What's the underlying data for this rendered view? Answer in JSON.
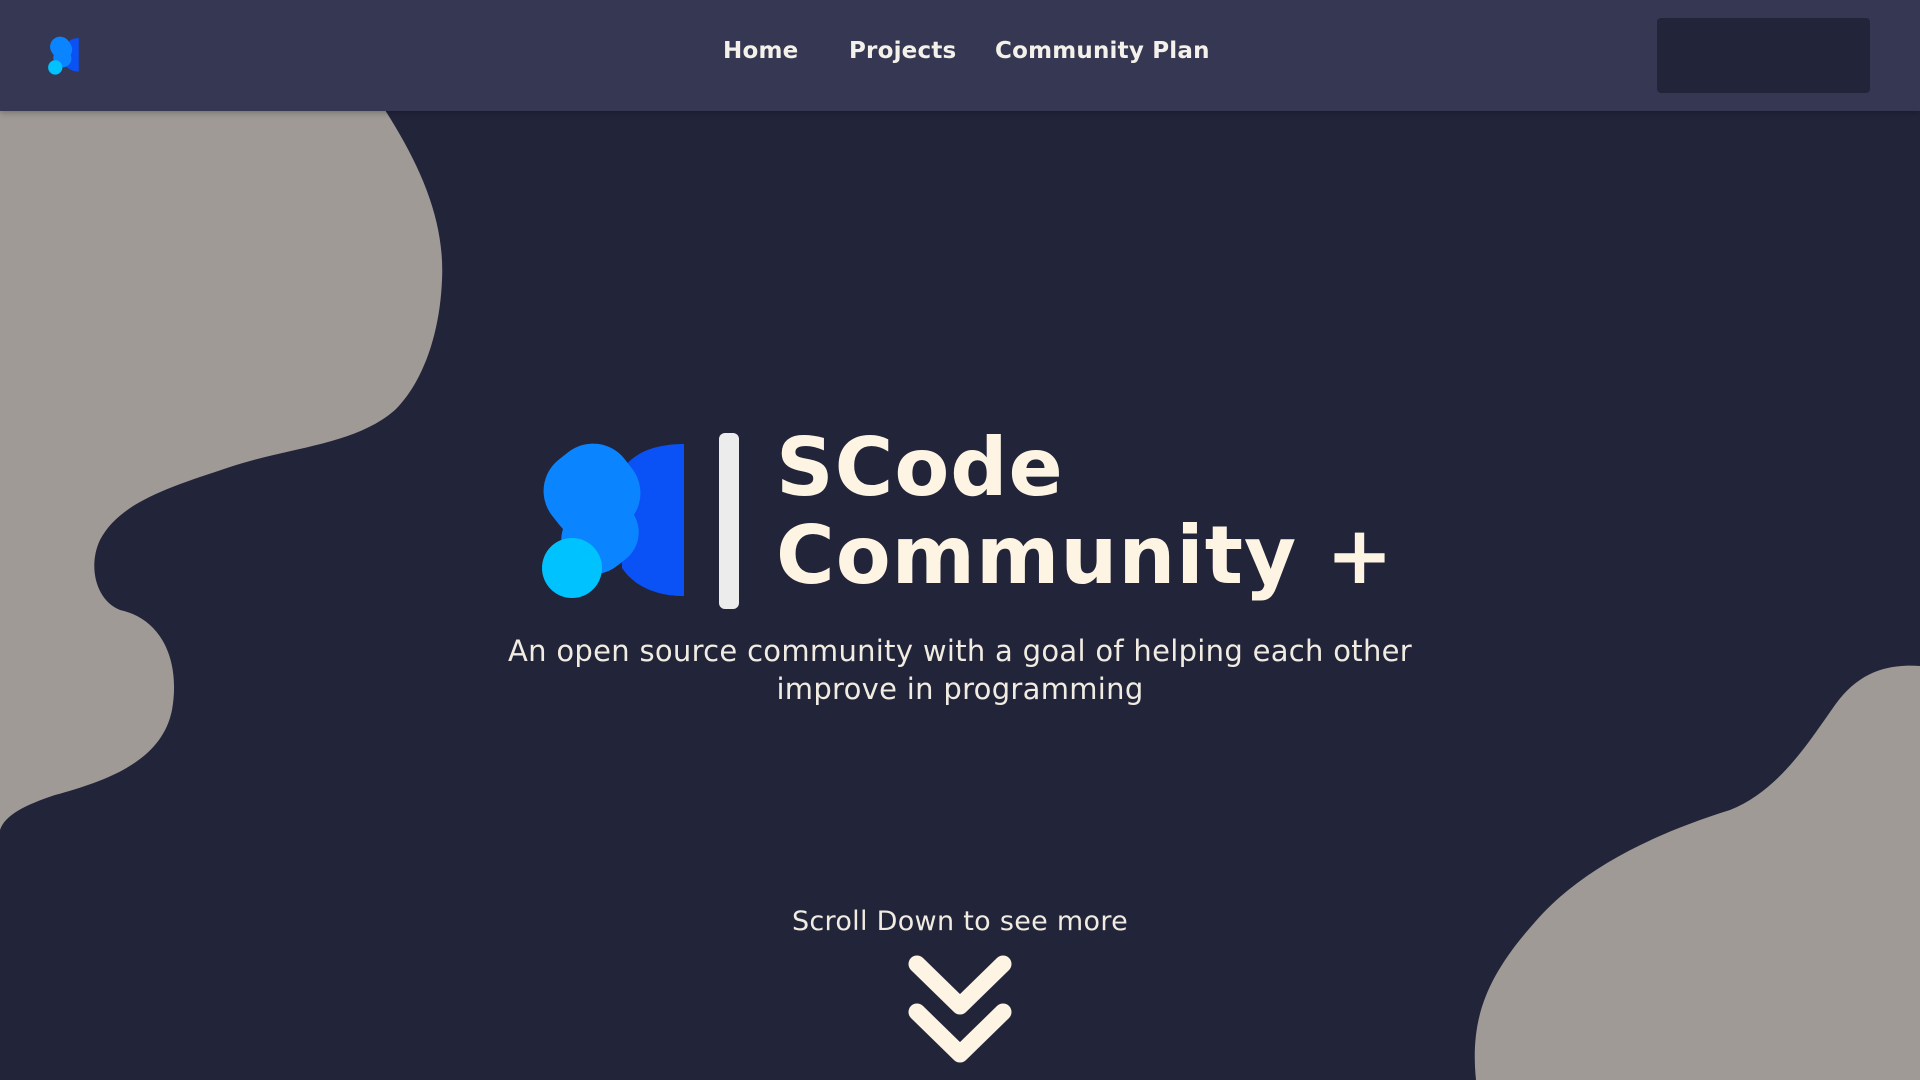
{
  "colors": {
    "page_background": "#22243a",
    "navbar_background": "#363752",
    "nav_action_background": "#22243a",
    "blob": "#9f9a96",
    "text_primary": "#fdf4e3",
    "logo_light_blue": "#00c2ff",
    "logo_mid_blue": "#0a84ff",
    "logo_dark_blue": "#0a52f5"
  },
  "navbar": {
    "logo_icon": "scode-logo-icon",
    "links": [
      {
        "label": "Home"
      },
      {
        "label": "Projects"
      },
      {
        "label": "Community Plan"
      }
    ],
    "action_label": ""
  },
  "hero": {
    "logo_icon": "scode-logo-icon",
    "title_line1": "SCode",
    "title_line2": "Community +",
    "subtitle": "An open source community with a goal of helping each other improve in programming"
  },
  "scroll": {
    "label": "Scroll Down to see more",
    "icon": "double-chevron-down-icon"
  }
}
